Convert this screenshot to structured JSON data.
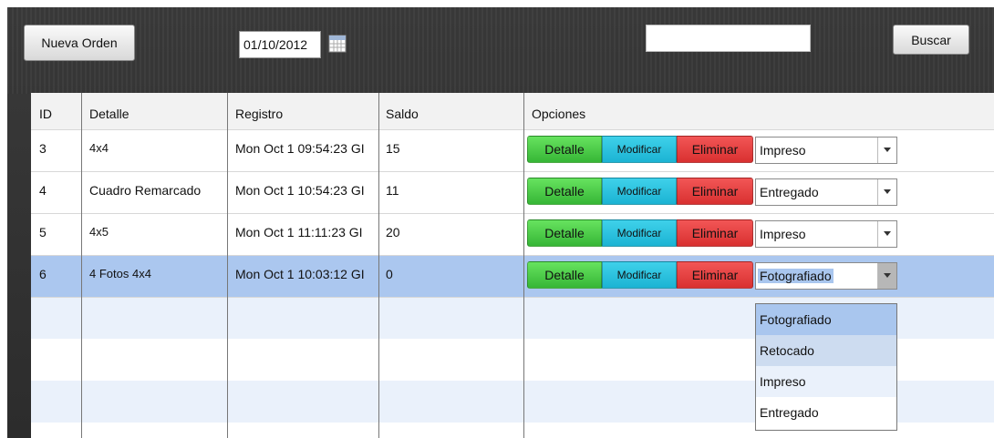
{
  "toolbar": {
    "new_order_label": "Nueva Orden",
    "date_value": "01/10/2012",
    "search_value": "",
    "search_button_label": "Buscar"
  },
  "table": {
    "columns": [
      "ID",
      "Detalle",
      "Registro",
      "Saldo",
      "Opciones"
    ],
    "rows": [
      {
        "id": "3",
        "detalle": "4x4",
        "registro": "Mon Oct 1 09:54:23 GI",
        "saldo": "15",
        "estado": "Impreso",
        "selected": false
      },
      {
        "id": "4",
        "detalle": "Cuadro Remarcado",
        "registro": "Mon Oct 1 10:54:23 GI",
        "saldo": "11",
        "estado": "Entregado",
        "selected": false
      },
      {
        "id": "5",
        "detalle": "4x5",
        "registro": "Mon Oct 1 11:11:23 GI",
        "saldo": "20",
        "estado": "Impreso",
        "selected": false
      },
      {
        "id": "6",
        "detalle": "4 Fotos 4x4",
        "registro": "Mon Oct 1 10:03:12 GI",
        "saldo": "0",
        "estado": "Fotografiado",
        "selected": true
      }
    ],
    "option_buttons": {
      "detalle": "Detalle",
      "modificar": "Modificar",
      "eliminar": "Eliminar"
    }
  },
  "dropdown": {
    "options": [
      "Fotografiado",
      "Retocado",
      "Impreso",
      "Entregado"
    ],
    "selected": "Fotografiado",
    "hovered": "Retocado"
  },
  "colors": {
    "selected_row": "#abc7ef",
    "alt_row": "#eaf1fb",
    "detalle_button": "#4ccd47",
    "modificar_button": "#2cc1de",
    "eliminar_button": "#e63e3e"
  }
}
